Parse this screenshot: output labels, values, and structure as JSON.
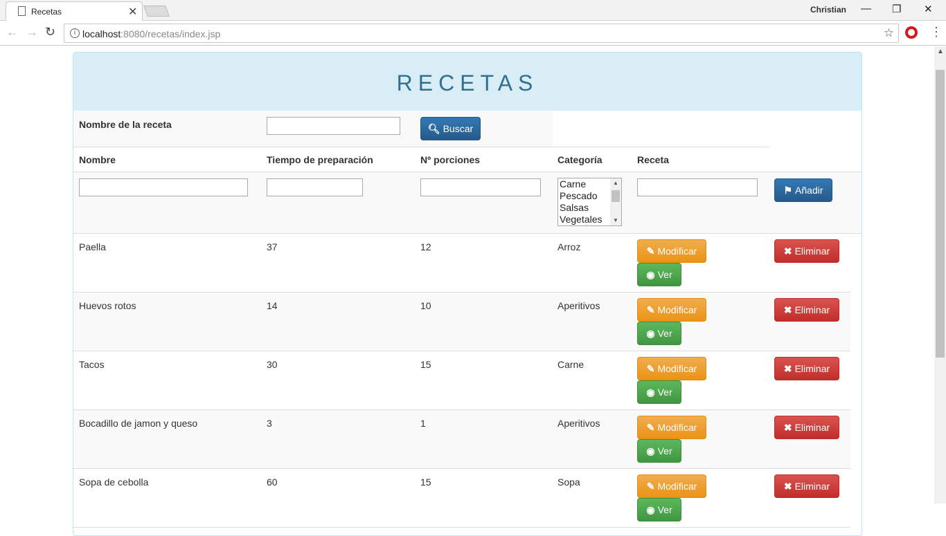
{
  "browser": {
    "tab_title": "Recetas",
    "tab_close": "✕",
    "profile_name": "Christian",
    "url_host": "localhost",
    "url_rest": ":8080/recetas/index.jsp",
    "win_minimize": "—",
    "win_restore": "❐",
    "win_close": "✕"
  },
  "page": {
    "title": "RECETAS",
    "search": {
      "label": "Nombre de la receta",
      "button_label": "Buscar",
      "value": ""
    },
    "columns": {
      "nombre": "Nombre",
      "tiempo": "Tiempo de preparación",
      "porciones": "Nº porciones",
      "categoria": "Categoría",
      "receta": "Receta"
    },
    "add_form": {
      "categories": [
        "Carne",
        "Pescado",
        "Salsas",
        "Vegetales"
      ],
      "add_button": "Añadir"
    },
    "actions": {
      "modify": "Modificar",
      "view": "Ver",
      "delete": "Eliminar"
    },
    "recipes": [
      {
        "nombre": "Paella",
        "tiempo": "37",
        "porciones": "12",
        "categoria": "Arroz"
      },
      {
        "nombre": "Huevos rotos",
        "tiempo": "14",
        "porciones": "10",
        "categoria": "Aperitivos"
      },
      {
        "nombre": "Tacos",
        "tiempo": "30",
        "porciones": "15",
        "categoria": "Carne"
      },
      {
        "nombre": "Bocadillo de jamon y queso",
        "tiempo": "3",
        "porciones": "1",
        "categoria": "Aperitivos"
      },
      {
        "nombre": "Sopa de cebolla",
        "tiempo": "60",
        "porciones": "15",
        "categoria": "Sopa"
      }
    ]
  }
}
